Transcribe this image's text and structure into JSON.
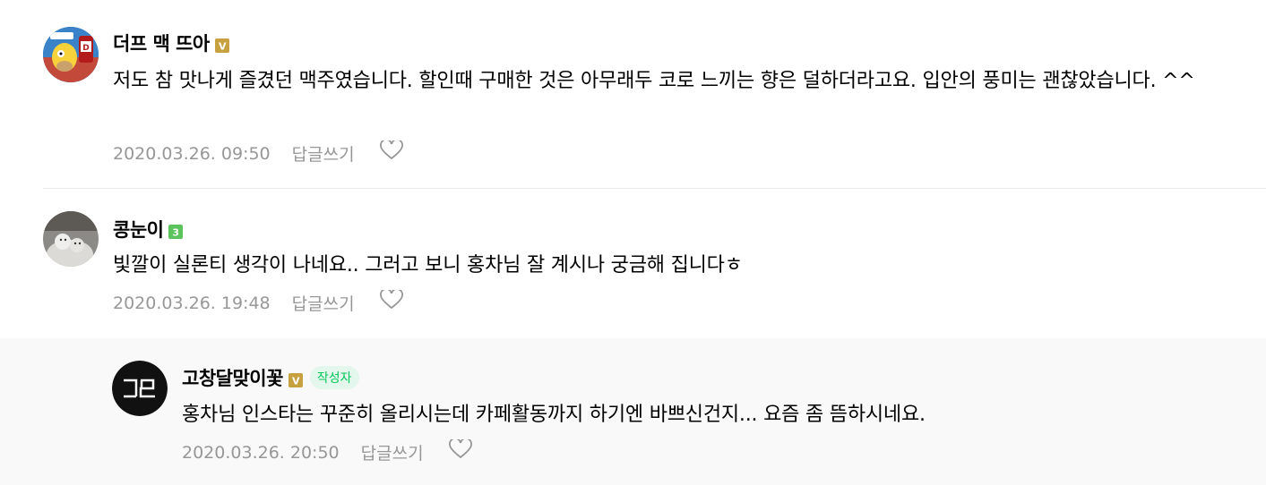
{
  "comments": [
    {
      "nickname": "더프 맥 뜨아",
      "avatar_icon": "simpsons-homer-avatar",
      "level_badge": "V",
      "text": "저도 참 맛나게 즐겼던 맥주였습니다. 할인때 구매한 것은 아무래두 코로 느끼는 향은 덜하더라고요. 입안의 풍미는 괜찮았습니다. ^^",
      "date": "2020.03.26. 09:50",
      "reply_label": "답글쓰기"
    },
    {
      "nickname": "콩눈이",
      "avatar_icon": "snowman-photo-avatar",
      "level_badge": "3",
      "text": "빛깔이 실론티 생각이 나네요.. 그러고 보니 홍차님 잘 계시나 궁금해 집니다ㅎ",
      "date": "2020.03.26. 19:48",
      "reply_label": "답글쓰기"
    },
    {
      "nickname": "고창달맞이꽃",
      "avatar_icon": "gochang-logo-avatar",
      "level_badge": "V",
      "author_tag": "작성자",
      "text": "홍차님 인스타는 꾸준히 올리시는데 카페활동까지 하기엔 바쁘신건지... 요즘 좀 뜸하시네요.",
      "date": "2020.03.26. 20:50",
      "reply_label": "답글쓰기"
    }
  ],
  "colors": {
    "badge_gold": "#c7a03f",
    "badge_green": "#5cc45d",
    "author_tag_bg": "#e3f7ec",
    "author_tag_text": "#03c75a",
    "meta_gray": "#979797",
    "reply_bg": "#f9f9fa"
  }
}
